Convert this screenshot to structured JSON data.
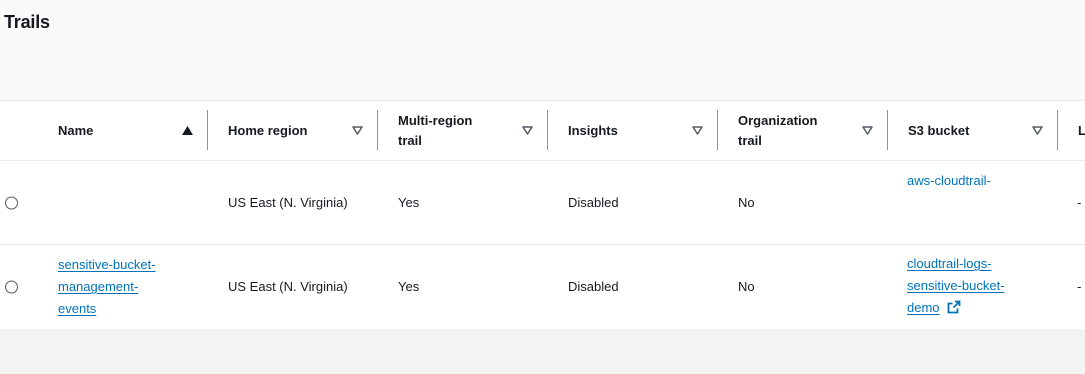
{
  "title": "Trails",
  "columns": [
    {
      "label_line1": "Name",
      "label_line2": "",
      "sort": "ascending"
    },
    {
      "label_line1": "Home region",
      "label_line2": "",
      "sort": "none"
    },
    {
      "label_line1": "Multi-region",
      "label_line2": "trail",
      "sort": "none"
    },
    {
      "label_line1": "Insights",
      "label_line2": "",
      "sort": "none"
    },
    {
      "label_line1": "Organization",
      "label_line2": "trail",
      "sort": "none"
    },
    {
      "label_line1": "S3 bucket",
      "label_line2": "",
      "sort": "none"
    },
    {
      "label_line1": "L",
      "label_line2": "",
      "sort": "none"
    }
  ],
  "rows": [
    {
      "name_lines": [
        "",
        "",
        ""
      ],
      "home_region": "US East (N. Virginia)",
      "multi_region": "Yes",
      "insights": "Disabled",
      "organization": "No",
      "s3_bucket_lines": [
        "aws-cloudtrail-"
      ],
      "last": "-"
    },
    {
      "name_lines": [
        "sensitive-bucket-",
        "management-",
        "events"
      ],
      "home_region": "US East (N. Virginia)",
      "multi_region": "Yes",
      "insights": "Disabled",
      "organization": "No",
      "s3_bucket_lines": [
        "cloudtrail-logs-",
        "sensitive-bucket-",
        "demo"
      ],
      "last": "-"
    }
  ],
  "colors": {
    "link": "#0073bb",
    "text": "#16191f",
    "header_bg": "#fafafa",
    "footer_bg": "#f2f3f3"
  },
  "icons": {
    "sort_ascending": "triangle-up-filled",
    "sort_none": "triangle-down-outline",
    "external_link": "external-link-icon"
  }
}
